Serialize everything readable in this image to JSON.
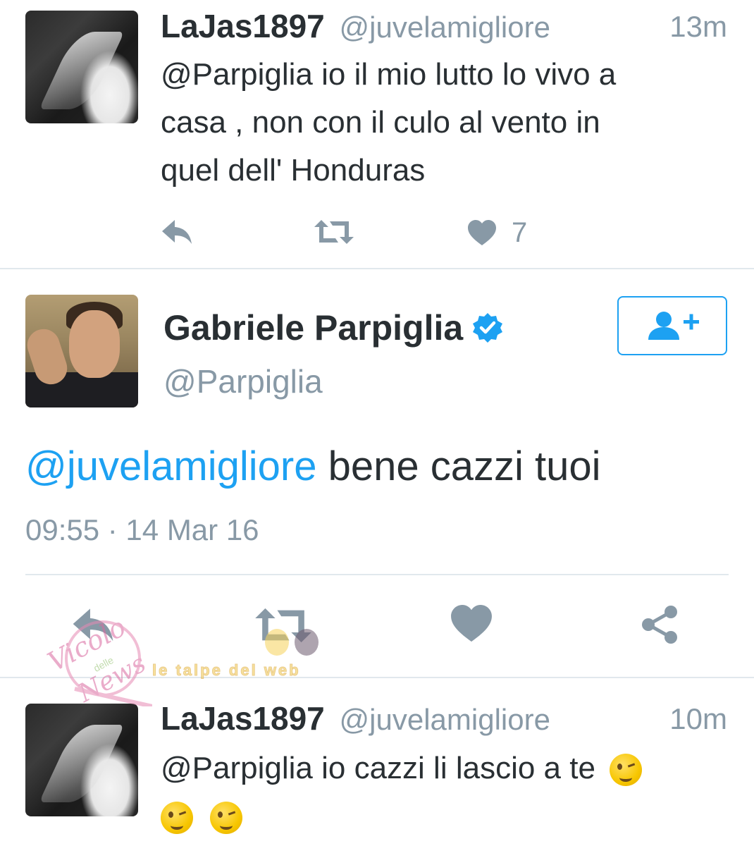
{
  "tweet1": {
    "display_name": "LaJas1897",
    "handle": "@juvelamigliore",
    "time": "13m",
    "text_lines": [
      "@Parpiglia io il mio lutto lo vivo a",
      "casa ,  non con il culo al vento in",
      "quel dell' Honduras"
    ],
    "like_count": "7"
  },
  "main_tweet": {
    "display_name": "Gabriele Parpiglia",
    "handle": "@Parpiglia",
    "mention": "@juvelamigliore",
    "text": " bene cazzi tuoi",
    "timestamp": "09:55 · 14 Mar 16"
  },
  "tweet3": {
    "display_name": "LaJas1897",
    "handle": "@juvelamigliore",
    "time": "10m",
    "text_line1": "@Parpiglia io cazzi li lascio a te"
  },
  "watermarks": {
    "vicolo_line1": "Vicolo",
    "vicolo_line2": "delle",
    "vicolo_line3": "News",
    "tagline": "le talpe del web"
  },
  "icons": [
    "reply-icon",
    "retweet-icon",
    "heart-icon",
    "share-icon",
    "follow-icon",
    "verified-badge-icon"
  ],
  "colors": {
    "link_blue": "#1da1f2",
    "action_gray": "#8899a6",
    "text_dark": "#292f33",
    "separator": "#e1e8ed"
  }
}
